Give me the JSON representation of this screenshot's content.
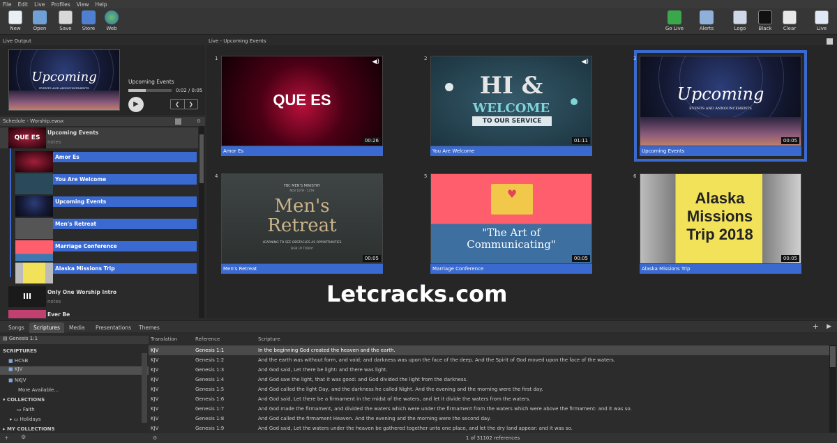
{
  "menu": [
    "File",
    "Edit",
    "Live",
    "Profiles",
    "View",
    "Help"
  ],
  "toolbar": {
    "new": "New",
    "open": "Open",
    "save": "Save",
    "store": "Store",
    "web": "Web",
    "golive": "Go Live",
    "alerts": "Alerts",
    "logo": "Logo",
    "black": "Black",
    "clear": "Clear",
    "live": "Live"
  },
  "live_output": {
    "header": "Live Output",
    "title": "Upcoming Events",
    "time": "0:02 / 0:05",
    "progress": 0.4,
    "preview_word": "Upcoming",
    "preview_sub": "EVENTS AND ANNOUNCEMENTS"
  },
  "schedule": {
    "header": "Schedule - Worship.ewsx",
    "group1": {
      "title": "Upcoming Events",
      "notes": "notes",
      "thumb": "QUE ES"
    },
    "items": [
      "Amor Es",
      "You Are Welcome",
      "Upcoming Events",
      "Men's Retreat",
      "Marriage Conference",
      "Alaska Missions Trip"
    ],
    "group2": {
      "title": "Only One Worship Intro",
      "notes": "notes",
      "thumb": "III"
    },
    "group3": {
      "title": "Ever Be"
    }
  },
  "live": {
    "header": "Live - Upcoming Events",
    "slides": [
      {
        "n": "1",
        "cap": "Amor Es",
        "dur": "00:26",
        "text": "QUE ES"
      },
      {
        "n": "2",
        "cap": "You Are Welcome",
        "dur": "01:11",
        "t1": "HI &",
        "t2": "WELCOME",
        "t3": "TO OUR SERVICE"
      },
      {
        "n": "3",
        "cap": "Upcoming Events",
        "dur": "00:05",
        "t1": "Upcoming",
        "t2": "EVENTS AND ANNOUNCEMENTS"
      },
      {
        "n": "4",
        "cap": "Men's Retreat",
        "dur": "00:05",
        "t0": "FBC MEN'S MINISTRY",
        "t0b": "NOV 10TH - 12TH",
        "t1": "Men's",
        "t2": "Retreat",
        "t3": "LEARNING TO SEE OBSTACLES AS OPPORTUNITIES",
        "t4": "SIGN UP TODAY!"
      },
      {
        "n": "5",
        "cap": "Marriage Conference",
        "dur": "00:05",
        "t1": "\"The Art of",
        "t2": "Communicating\""
      },
      {
        "n": "6",
        "cap": "Alaska Missions Trip",
        "dur": "00:05",
        "t1": "Alaska",
        "t2": "Missions",
        "t3": "Trip 2018"
      }
    ]
  },
  "watermark": "Letcracks.com",
  "tabs": [
    "Songs",
    "Scriptures",
    "Media",
    "Presentations",
    "Themes"
  ],
  "library": {
    "search": "Genesis 1:1",
    "scriptures": "SCRIPTURES",
    "versions": [
      "HCSB",
      "KJV",
      "NKJV"
    ],
    "more": "More Available...",
    "collections": "COLLECTIONS",
    "coll": [
      "Faith",
      "Holidays"
    ],
    "my": "MY COLLECTIONS"
  },
  "table": {
    "headers": [
      "Translation",
      "Reference",
      "Scripture"
    ],
    "rows": [
      [
        "KJV",
        "Genesis 1:1",
        "In the beginning God created the heaven and the earth."
      ],
      [
        "KJV",
        "Genesis 1:2",
        "And the earth was without form, and void; and darkness was upon the face of the deep. And the Spirit of God moved upon the face of the waters."
      ],
      [
        "KJV",
        "Genesis 1:3",
        "And God said, Let there be light: and there was light."
      ],
      [
        "KJV",
        "Genesis 1:4",
        "And God saw the light, that it was good: and God divided the light from the darkness."
      ],
      [
        "KJV",
        "Genesis 1:5",
        "And God called the light Day, and the darkness he called Night. And the evening and the morning were the first day."
      ],
      [
        "KJV",
        "Genesis 1:6",
        "And God said, Let there be a firmament in the midst of the waters, and let it divide the waters from the waters."
      ],
      [
        "KJV",
        "Genesis 1:7",
        "And God made the firmament, and divided the waters which were under the firmament from the waters which were above the firmament: and it was so."
      ],
      [
        "KJV",
        "Genesis 1:8",
        "And God called the firmament Heaven. And the evening and the morning were the second day."
      ],
      [
        "KJV",
        "Genesis 1:9",
        "And God said, Let the waters under the heaven be gathered together unto one place, and let the dry land appear: and it was so."
      ]
    ],
    "status": "1 of 31102 references"
  }
}
